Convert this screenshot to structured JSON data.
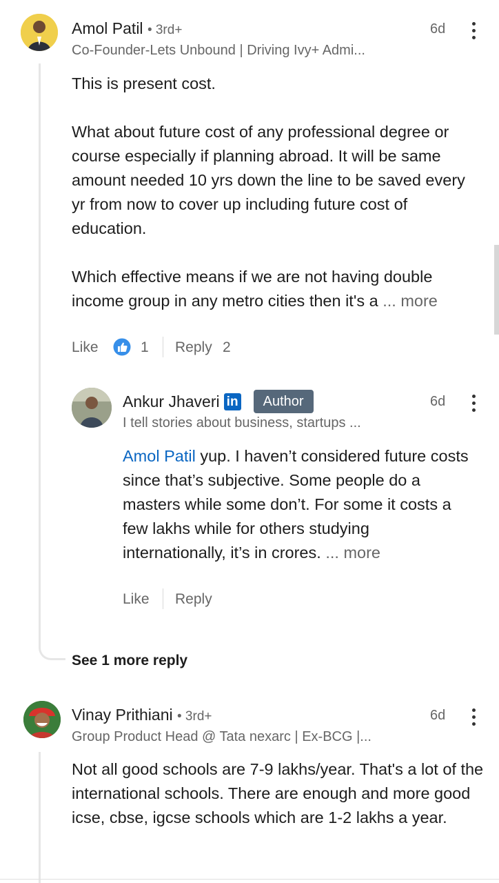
{
  "comments": [
    {
      "author": "Amol Patil",
      "degree": "• 3rd+",
      "headline": "Co-Founder-Lets Unbound | Driving Ivy+ Admi...",
      "time": "6d",
      "paragraphs": [
        "This is present cost.",
        "What about future cost of any professional degree or course especially if planning abroad. It will be same amount needed 10 yrs down the line to be saved every yr from now to cover up including future cost of education.",
        "Which effective means if we are not having double income group in any metro cities then it's a"
      ],
      "more_label": "... more",
      "like_label": "Like",
      "like_count": "1",
      "reply_label": "Reply",
      "reply_count": "2"
    },
    {
      "author": "Vinay Prithiani",
      "degree": "• 3rd+",
      "headline": "Group Product Head @ Tata nexarc | Ex-BCG |...",
      "time": "6d",
      "paragraphs": [
        "Not all good schools are 7-9 lakhs/year. That's a lot of the international schools. There are enough and more good icse, cbse, igcse schools which are 1-2 lakhs a year."
      ]
    }
  ],
  "reply": {
    "author": "Ankur Jhaveri",
    "linkedin_badge": "in",
    "author_badge": "Author",
    "headline": "I tell stories about business, startups ...",
    "time": "6d",
    "mention": "Amol Patil",
    "text": " yup. I haven’t considered future costs since that’s subjective. Some people do a masters while some don’t. For some it costs a few lakhs while for others studying internationally, it’s in crores.",
    "more_label": "... more",
    "like_label": "Like",
    "reply_label": "Reply"
  },
  "see_more_replies": "See 1 more reply",
  "colors": {
    "link": "#0a66c2",
    "like_reaction": "#378fe9",
    "author_badge_bg": "#56687a"
  },
  "icons": [
    "like-reaction-icon",
    "linkedin-icon",
    "more-options-icon"
  ]
}
